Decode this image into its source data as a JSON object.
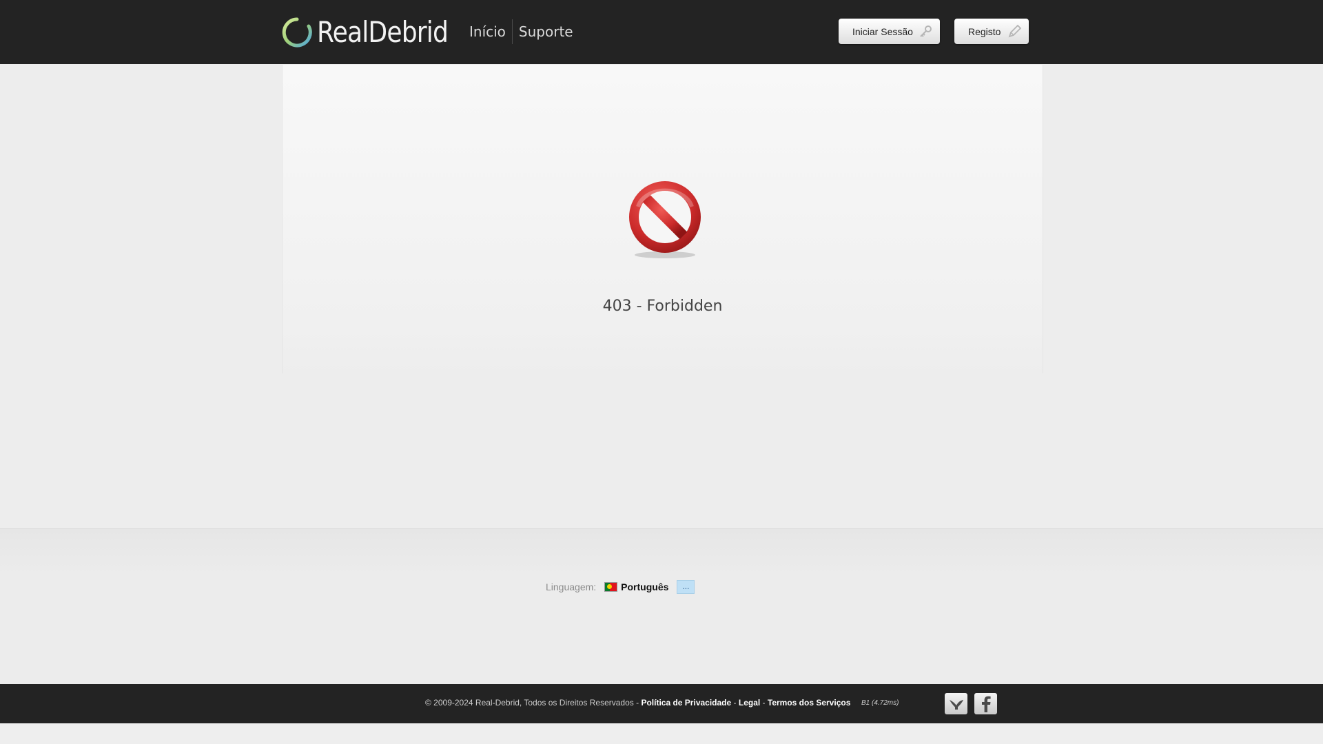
{
  "header": {
    "logo_text": "RealDebrid",
    "nav": [
      {
        "label": "Início"
      },
      {
        "label": "Suporte"
      }
    ],
    "login_label": "Iniciar Sessão",
    "register_label": "Registo"
  },
  "main": {
    "error_message": "403 - Forbidden"
  },
  "language": {
    "label": "Linguagem:",
    "current": "Português",
    "more_label": "..."
  },
  "footer": {
    "copyright": "© 2009-2024 Real-Debrid, Todos os Direitos Reservados - ",
    "privacy": "Política de Privacidade",
    "sep1": " - ",
    "legal": "Legal",
    "sep2": " - ",
    "terms": "Termos dos Serviços",
    "render_time": "B1 (4.72ms)"
  },
  "colors": {
    "header_bg": "#232323",
    "error_red": "#c9262b",
    "logo_ring_green": "#a8d46a",
    "logo_ring_blue": "#5aaee0"
  },
  "icons": {
    "login": "key-icon",
    "register": "pencil-icon",
    "error": "forbidden-icon",
    "social": [
      "twitter-icon",
      "facebook-icon"
    ]
  }
}
